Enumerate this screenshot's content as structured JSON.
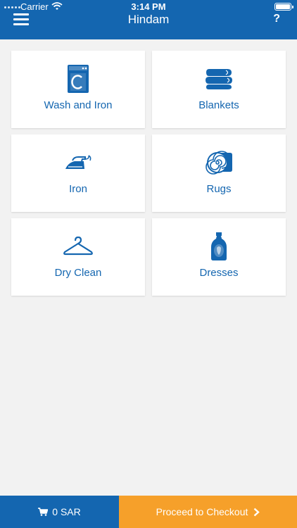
{
  "status_bar": {
    "carrier": "Carrier",
    "time": "3:14 PM"
  },
  "header": {
    "title": "Hindam",
    "help_label": "?"
  },
  "services": [
    {
      "label": "Wash and Iron",
      "icon": "washing-machine-icon"
    },
    {
      "label": "Blankets",
      "icon": "folded-blankets-icon"
    },
    {
      "label": "Iron",
      "icon": "iron-icon"
    },
    {
      "label": "Rugs",
      "icon": "rolled-rug-icon"
    },
    {
      "label": "Dry Clean",
      "icon": "hanger-icon"
    },
    {
      "label": "Dresses",
      "icon": "detergent-bottle-icon"
    }
  ],
  "footer": {
    "cart_total": "0 SAR",
    "checkout_label": "Proceed to Checkout"
  },
  "colors": {
    "primary": "#1466b0",
    "accent": "#f6a02a",
    "background": "#f2f2f2"
  }
}
